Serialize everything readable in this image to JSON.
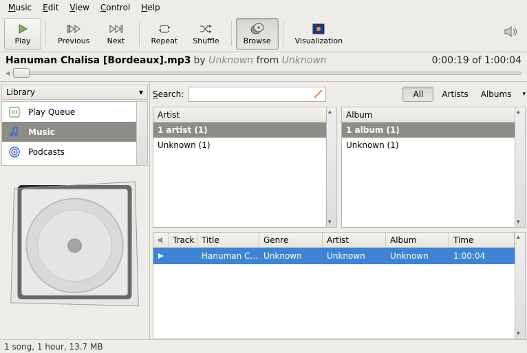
{
  "menubar": [
    "Music",
    "Edit",
    "View",
    "Control",
    "Help"
  ],
  "toolbar": {
    "play": "Play",
    "previous": "Previous",
    "next": "Next",
    "repeat": "Repeat",
    "shuffle": "Shuffle",
    "browse": "Browse",
    "visualization": "Visualization"
  },
  "nowplaying": {
    "title": "Hanuman Chalisa [Bordeaux].mp3",
    "by_word": "by",
    "artist": "Unknown",
    "from_word": "from",
    "album": "Unknown",
    "elapsed": "0:00:19",
    "of_word": "of",
    "total": "1:00:04"
  },
  "library": {
    "header": "Library",
    "items": [
      "Play Queue",
      "Music",
      "Podcasts"
    ]
  },
  "search": {
    "label": "Search:",
    "placeholder": ""
  },
  "filters": {
    "all": "All",
    "artists": "Artists",
    "albums": "Albums"
  },
  "artist_pane": {
    "header": "Artist",
    "summary": "1 artist (1)",
    "rows": [
      "Unknown (1)"
    ]
  },
  "album_pane": {
    "header": "Album",
    "summary": "1 album (1)",
    "rows": [
      "Unknown (1)"
    ]
  },
  "track_table": {
    "headers": {
      "track": "Track",
      "title": "Title",
      "genre": "Genre",
      "artist": "Artist",
      "album": "Album",
      "time": "Time"
    },
    "rows": [
      {
        "track": "",
        "title": "Hanuman C…",
        "genre": "Unknown",
        "artist": "Unknown",
        "album": "Unknown",
        "time": "1:00:04"
      }
    ]
  },
  "statusbar": "1 song, 1 hour, 13.7 MB"
}
